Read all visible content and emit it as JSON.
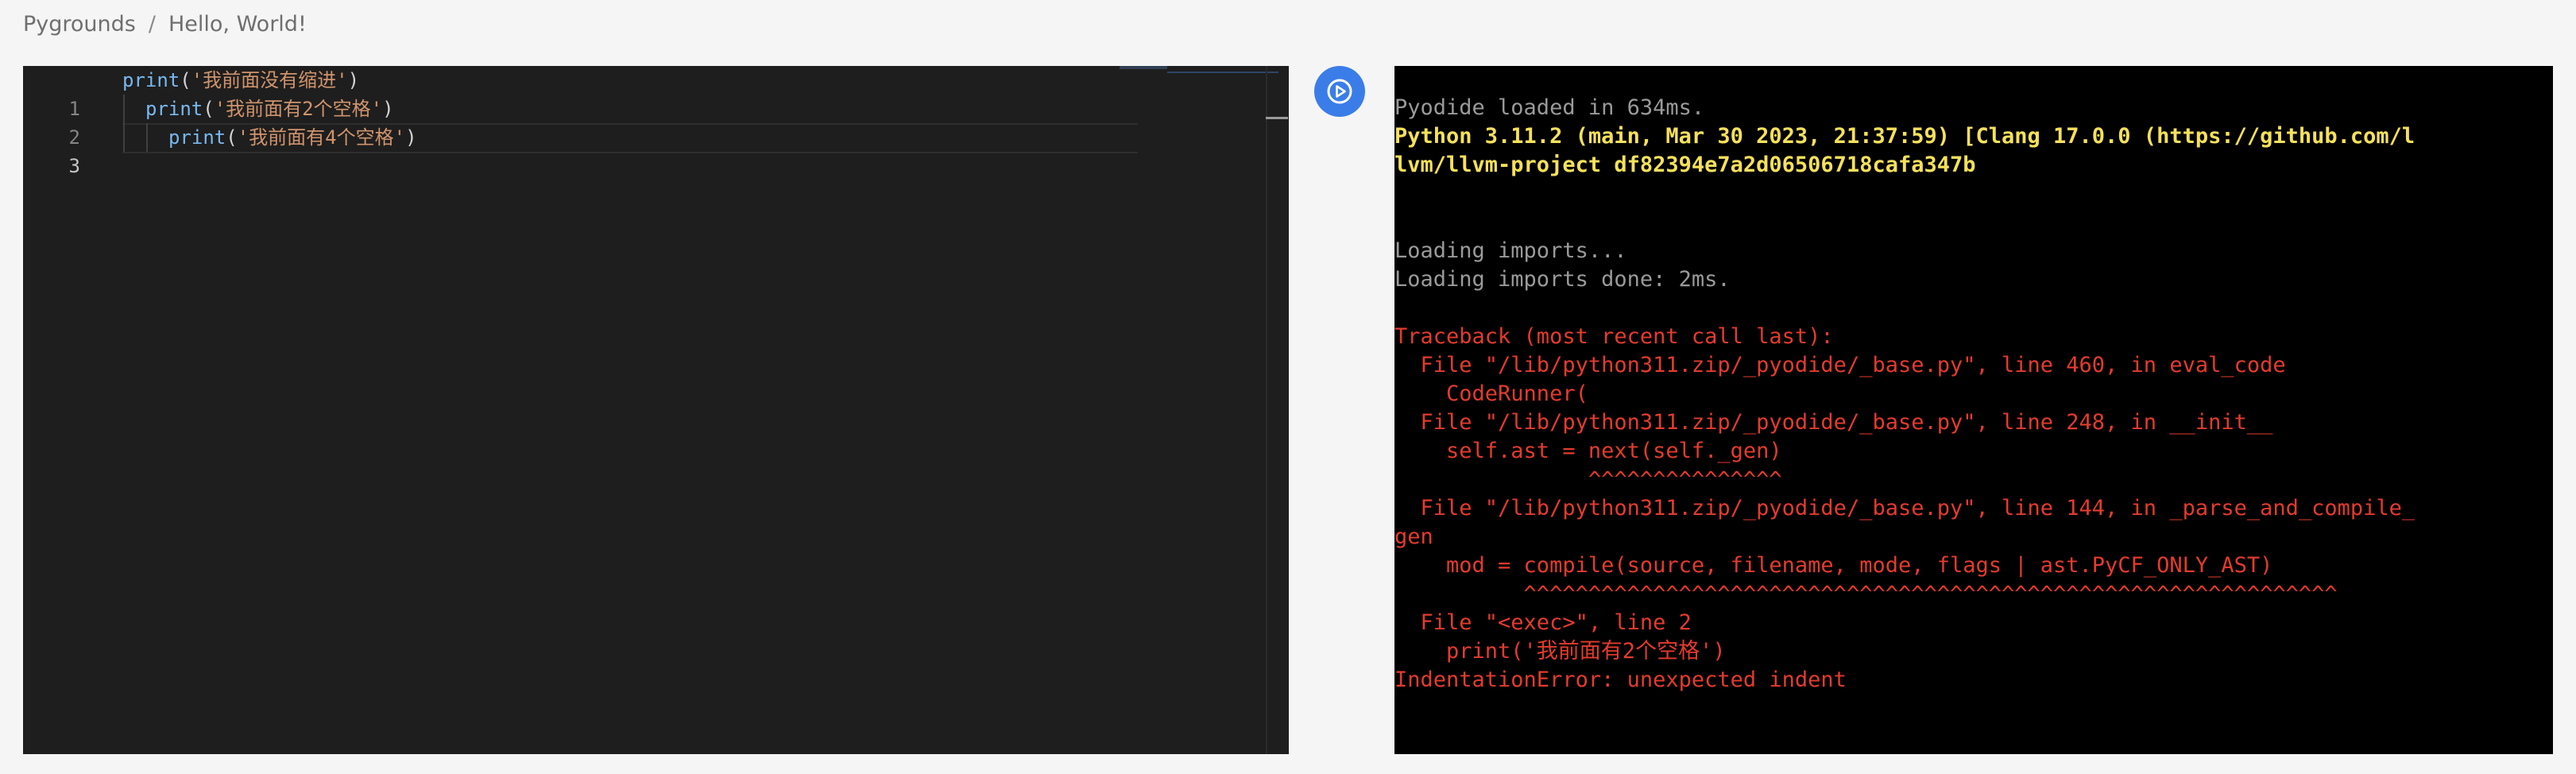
{
  "breadcrumb": {
    "root": "Pygrounds",
    "separator": "/",
    "current": "Hello, World!"
  },
  "editor": {
    "lines": [
      {
        "number": "1",
        "fn": "print",
        "open": "(",
        "string": "'我前面没有缩进'",
        "close": ")"
      },
      {
        "number": "2",
        "fn": "print",
        "open": "(",
        "string": "'我前面有2个空格'",
        "close": ")"
      },
      {
        "number": "3",
        "fn": "print",
        "open": "(",
        "string": "'我前面有4个空格'",
        "close": ")"
      }
    ],
    "current_line": "3"
  },
  "run_button": {
    "icon": "play-circle-icon",
    "color": "#3b7de8"
  },
  "console": {
    "lines": [
      {
        "text": "Pyodide loaded in 634ms.",
        "style": "info"
      },
      {
        "text": "Python 3.11.2 (main, Mar 30 2023, 21:37:59) [Clang 17.0.0 (https://github.com/l",
        "style": "banner"
      },
      {
        "text": "lvm/llvm-project df82394e7a2d06506718cafa347b",
        "style": "banner"
      },
      {
        "text": "",
        "style": "info"
      },
      {
        "text": "",
        "style": "info"
      },
      {
        "text": "Loading imports...",
        "style": "info"
      },
      {
        "text": "Loading imports done: 2ms.",
        "style": "info"
      },
      {
        "text": "",
        "style": "info"
      },
      {
        "text": "Traceback (most recent call last):",
        "style": "error"
      },
      {
        "text": "  File \"/lib/python311.zip/_pyodide/_base.py\", line 460, in eval_code",
        "style": "error"
      },
      {
        "text": "    CodeRunner(",
        "style": "error"
      },
      {
        "text": "  File \"/lib/python311.zip/_pyodide/_base.py\", line 248, in __init__",
        "style": "error"
      },
      {
        "text": "    self.ast = next(self._gen)",
        "style": "error"
      },
      {
        "text": "               ^^^^^^^^^^^^^^^",
        "style": "error"
      },
      {
        "text": "  File \"/lib/python311.zip/_pyodide/_base.py\", line 144, in _parse_and_compile_",
        "style": "error"
      },
      {
        "text": "gen",
        "style": "error"
      },
      {
        "text": "    mod = compile(source, filename, mode, flags | ast.PyCF_ONLY_AST)",
        "style": "error"
      },
      {
        "text": "          ^^^^^^^^^^^^^^^^^^^^^^^^^^^^^^^^^^^^^^^^^^^^^^^^^^^^^^^^^^^^^^^",
        "style": "error"
      },
      {
        "text": "  File \"<exec>\", line 2",
        "style": "error"
      },
      {
        "text": "    print('我前面有2个空格')",
        "style": "error"
      },
      {
        "text": "IndentationError: unexpected indent",
        "style": "error"
      }
    ]
  },
  "colors": {
    "page_bg": "#f5f5f5",
    "editor_bg": "#1e1e1e",
    "console_bg": "#000000",
    "info_text": "#9a9a9a",
    "banner_text": "#f5e15a",
    "error_text": "#e33b2e"
  }
}
